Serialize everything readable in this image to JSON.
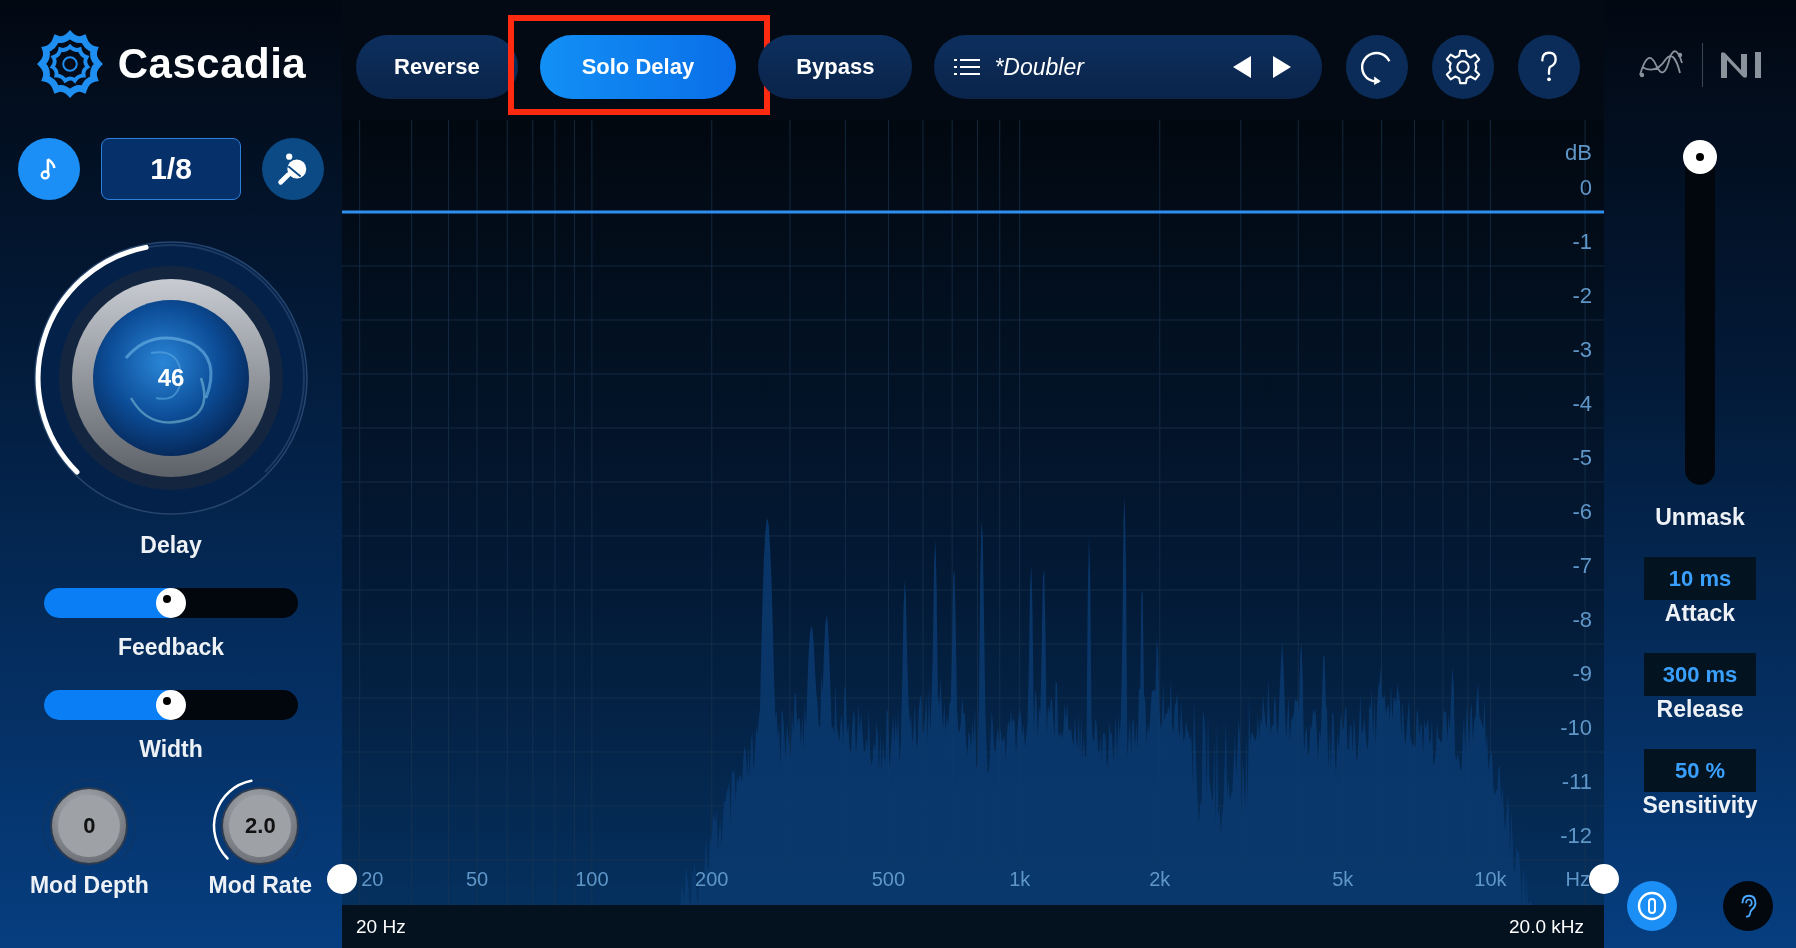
{
  "logo": {
    "title": "Cascadia"
  },
  "tempo": {
    "sync_on": true,
    "value": "1/8",
    "ping_pong": false
  },
  "delay_knob": {
    "value": "46",
    "label": "Delay",
    "level": 0.46
  },
  "sliders": [
    {
      "label": "Feedback",
      "level": 0.5
    },
    {
      "label": "Width",
      "level": 0.5
    }
  ],
  "mod_knobs": [
    {
      "value": "0",
      "label": "Mod Depth"
    },
    {
      "value": "2.0",
      "label": "Mod Rate",
      "level": 0.46
    }
  ],
  "toolbar": {
    "buttons": [
      {
        "label": "Reverse",
        "selected": false,
        "highlighted": false
      },
      {
        "label": "Solo Delay",
        "selected": true,
        "highlighted": true
      },
      {
        "label": "Bypass",
        "selected": false,
        "highlighted": false
      }
    ],
    "preset": "*Doubler"
  },
  "analyzer": {
    "db_unit": "dB",
    "db_labels": [
      "0",
      "-1",
      "-2",
      "-3",
      "-4",
      "-5",
      "-6",
      "-7",
      "-8",
      "-9",
      "-10",
      "-11",
      "-12"
    ],
    "freq_labels": [
      "20",
      "50",
      "100",
      "200",
      "500",
      "1k",
      "2k",
      "5k",
      "10k",
      "Hz"
    ],
    "range_low": "20 Hz",
    "range_high": "20.0 kHz"
  },
  "unmask": {
    "label": "Unmask",
    "level": 1
  },
  "params": [
    {
      "value": "10 ms",
      "label": "Attack"
    },
    {
      "value": "300 ms",
      "label": "Release"
    },
    {
      "value": "50 %",
      "label": "Sensitivity"
    }
  ],
  "monitor": {
    "mode_on": true,
    "ear_on": false
  }
}
